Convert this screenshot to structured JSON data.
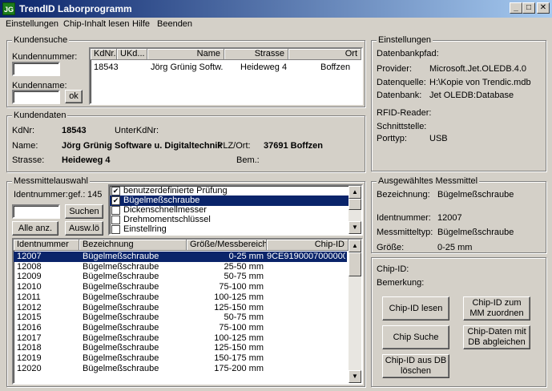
{
  "window": {
    "icon": "JG",
    "title": "TrendID Laborprogramm",
    "controls": [
      "_",
      "□",
      "✕"
    ]
  },
  "menu": [
    "Einstellungen",
    "Chip-Inhalt lesen",
    "Hilfe",
    "Beenden"
  ],
  "kundensuche": {
    "title": "Kundensuche",
    "kundennummer_label": "Kundennummer:",
    "kundennummer_value": "",
    "kundenname_label": "Kundenname:",
    "kundenname_value": "",
    "ok_label": "ok",
    "columns": [
      "KdNr.",
      "UKd...",
      "Name",
      "Strasse",
      "Ort"
    ],
    "rows": [
      {
        "kdnr": "18543",
        "ukd": "",
        "name": "Jörg Grünig Softw...",
        "strasse": "Heideweg 4",
        "ort": "Boffzen"
      }
    ]
  },
  "einstellungen": {
    "title": "Einstellungen",
    "datenbankpfad_label": "Datenbankpfad:",
    "provider_label": "Provider:",
    "provider_value": "Microsoft.Jet.OLEDB.4.0",
    "datenquelle_label": "Datenquelle:",
    "datenquelle_value": "H:\\Kopie von Trendic.mdb",
    "datenbank_label": "Datenbank:",
    "datenbank_value": "Jet OLEDB:Database",
    "rfid_label": "RFID-Reader:",
    "schnittstelle_label": "Schnittstelle:",
    "porttyp_label": "Porttyp:",
    "porttyp_value": "USB"
  },
  "kundendaten": {
    "title": "Kundendaten",
    "kdnr_label": "KdNr:",
    "kdnr_value": "18543",
    "unterkdnr_label": "UnterKdNr:",
    "unterkdnr_value": "",
    "name_label": "Name:",
    "name_value": "Jörg Grünig Software u. Digitaltechnik",
    "plzort_label": "PLZ/Ort:",
    "plzort_value": "37691 Boffzen",
    "strasse_label": "Strasse:",
    "strasse_value": "Heideweg 4",
    "bem_label": "Bem.:",
    "bem_value": ""
  },
  "messmittelauswahl": {
    "title": "Messmittelauswahl",
    "identnummer_label": "Identnummer:",
    "gef_label": "gef.:",
    "gef_value": "145",
    "search_value": "",
    "suchen_label": "Suchen",
    "alle_label": "Alle anz.",
    "auswlo_label": "Ausw.lö",
    "filters": [
      {
        "label": "benutzerdefinierte Prüfung",
        "checked": true,
        "selected": false
      },
      {
        "label": "Bügelmeßschraube",
        "checked": true,
        "selected": true
      },
      {
        "label": "Dickenschnellmesser",
        "checked": false,
        "selected": false
      },
      {
        "label": "Drehmomentschlüssel",
        "checked": false,
        "selected": false
      },
      {
        "label": "Einstellring",
        "checked": false,
        "selected": false
      }
    ],
    "columns": [
      "Identnummer",
      "Bezeichnung",
      "Größe/Messbereich",
      "Chip-ID"
    ],
    "rows": [
      {
        "id": "12007",
        "bez": "Bügelmeßschraube",
        "groesse": "0-25 mm",
        "chip": "9CE9190007000000",
        "selected": true
      },
      {
        "id": "12008",
        "bez": "Bügelmeßschraube",
        "groesse": "25-50 mm",
        "chip": "",
        "selected": false
      },
      {
        "id": "12009",
        "bez": "Bügelmeßschraube",
        "groesse": "50-75 mm",
        "chip": "",
        "selected": false
      },
      {
        "id": "12010",
        "bez": "Bügelmeßschraube",
        "groesse": "75-100 mm",
        "chip": "",
        "selected": false
      },
      {
        "id": "12011",
        "bez": "Bügelmeßschraube",
        "groesse": "100-125 mm",
        "chip": "",
        "selected": false
      },
      {
        "id": "12012",
        "bez": "Bügelmeßschraube",
        "groesse": "125-150 mm",
        "chip": "",
        "selected": false
      },
      {
        "id": "12015",
        "bez": "Bügelmeßschraube",
        "groesse": "50-75 mm",
        "chip": "",
        "selected": false
      },
      {
        "id": "12016",
        "bez": "Bügelmeßschraube",
        "groesse": "75-100 mm",
        "chip": "",
        "selected": false
      },
      {
        "id": "12017",
        "bez": "Bügelmeßschraube",
        "groesse": "100-125 mm",
        "chip": "",
        "selected": false
      },
      {
        "id": "12018",
        "bez": "Bügelmeßschraube",
        "groesse": "125-150 mm",
        "chip": "",
        "selected": false
      },
      {
        "id": "12019",
        "bez": "Bügelmeßschraube",
        "groesse": "150-175 mm",
        "chip": "",
        "selected": false
      },
      {
        "id": "12020",
        "bez": "Bügelmeßschraube",
        "groesse": "175-200 mm",
        "chip": "",
        "selected": false
      }
    ]
  },
  "ausgewaehlt": {
    "title": "Ausgewähltes Messmittel",
    "bezeichnung_label": "Bezeichnung:",
    "bezeichnung_value": "Bügelmeßschraube",
    "identnummer_label": "Identnummer:",
    "identnummer_value": "12007",
    "messmitteltyp_label": "Messmitteltyp:",
    "messmitteltyp_value": "Bügelmeßschraube",
    "groesse_label": "Größe:",
    "groesse_value": "0-25 mm"
  },
  "chip": {
    "chipid_label": "Chip-ID:",
    "bemerkung_label": "Bemerkung:",
    "buttons": {
      "lesen": "Chip-ID lesen",
      "zuordnen": "Chip-ID zum MM zuordnen",
      "suche": "Chip Suche",
      "abgleichen": "Chip-Daten mit DB abgleichen",
      "loeschen": "Chip-ID aus DB löschen"
    }
  },
  "colors": {
    "selection": "#0a246a",
    "face": "#d4d0c8"
  }
}
